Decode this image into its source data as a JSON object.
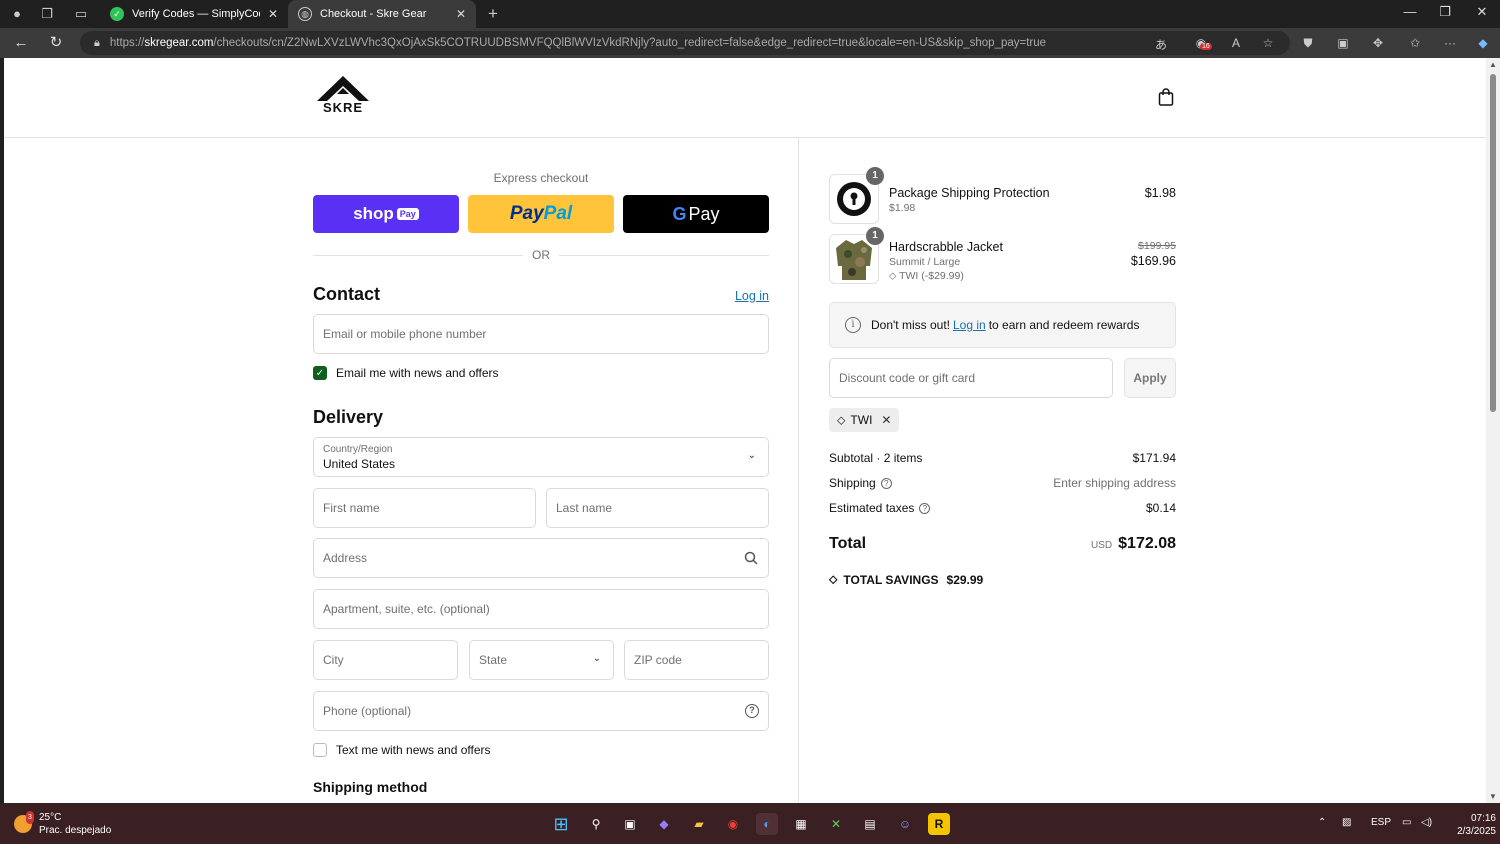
{
  "browser": {
    "tabs": [
      {
        "title": "Verify Codes — SimplyCodes",
        "icon": "simplycodes-check-icon"
      },
      {
        "title": "Checkout - Skre Gear",
        "icon": "globe-icon"
      }
    ],
    "url_prefix": "https://",
    "url_domain": "skregear.com",
    "url_path": "/checkouts/cn/Z2NwLXVzLWVhc3QxOjAxSk5COTRUUDBSMVFQQlBlWVIzVkdRNjly?auto_redirect=false&edge_redirect=true&locale=en-US&skip_shop_pay=true",
    "extension_badge": "16"
  },
  "header": {
    "logo_text": "SKRE",
    "cart_icon": "shopping-bag-icon"
  },
  "checkout": {
    "express_label": "Express checkout",
    "shop_pay_label": "shop",
    "shop_pay_badge": "Pay",
    "paypal_label_1": "Pay",
    "paypal_label_2": "Pal",
    "gpay_label": "Pay",
    "or_label": "OR",
    "contact_title": "Contact",
    "login_label": "Log in",
    "email_placeholder": "Email or mobile phone number",
    "email_news_label": "Email me with news and offers",
    "email_news_checked": true,
    "delivery_title": "Delivery",
    "country_label": "Country/Region",
    "country_value": "United States",
    "first_name_placeholder": "First name",
    "last_name_placeholder": "Last name",
    "address_placeholder": "Address",
    "apartment_placeholder": "Apartment, suite, etc. (optional)",
    "city_placeholder": "City",
    "state_placeholder": "State",
    "zip_placeholder": "ZIP code",
    "phone_placeholder": "Phone (optional)",
    "text_news_label": "Text me with news and offers",
    "text_news_checked": false,
    "shipping_method_title": "Shipping method"
  },
  "summary": {
    "items": [
      {
        "qty": "1",
        "name": "Package Shipping Protection",
        "sub": "$1.98",
        "price": "$1.98"
      },
      {
        "qty": "1",
        "name": "Hardscrabble Jacket",
        "sub": "Summit / Large",
        "discount": "TWI (-$29.99)",
        "original_price": "$199.95",
        "price": "$169.96"
      }
    ],
    "rewards_prefix": "Don't miss out!",
    "rewards_link": "Log in",
    "rewards_suffix": "to earn and redeem rewards",
    "discount_placeholder": "Discount code or gift card",
    "apply_label": "Apply",
    "applied_code": "TWI",
    "subtotal_label": "Subtotal · 2 items",
    "subtotal_value": "$171.94",
    "shipping_label": "Shipping",
    "shipping_value": "Enter shipping address",
    "taxes_label": "Estimated taxes",
    "taxes_value": "$0.14",
    "total_label": "Total",
    "currency": "USD",
    "total_value": "$172.08",
    "savings_label": "TOTAL SAVINGS",
    "savings_value": "$29.99"
  },
  "taskbar": {
    "weather_badge": "3",
    "temperature": "25°C",
    "weather_text": "Prac. despejado",
    "language": "ESP",
    "time": "07:16",
    "date": "2/3/2025"
  },
  "colors": {
    "shop_pay": "#5a31f4",
    "paypal": "#ffc439",
    "link": "#1773b0",
    "checkbox": "#0f5e1e"
  }
}
